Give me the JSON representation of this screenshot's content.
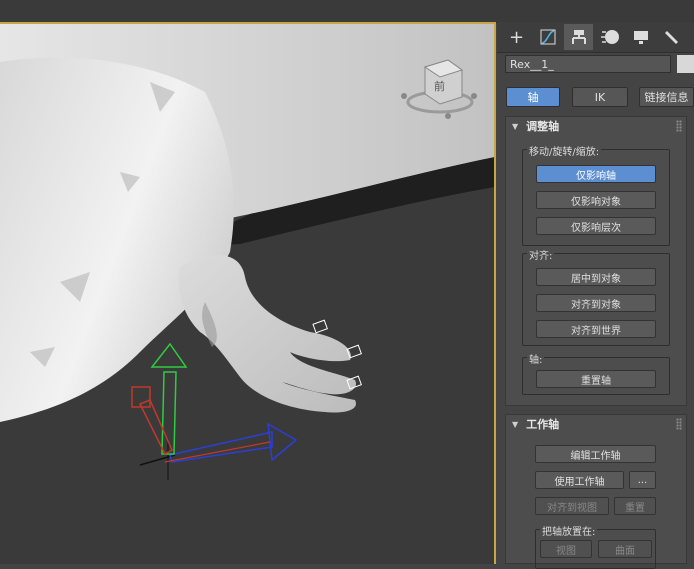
{
  "panel": {
    "tabs": [
      {
        "icon": "create-plus-icon"
      },
      {
        "icon": "modify-curve-icon"
      },
      {
        "icon": "hierarchy-icon",
        "active": true
      },
      {
        "icon": "motion-icon"
      },
      {
        "icon": "display-monitor-icon"
      },
      {
        "icon": "utilities-wrench-icon"
      }
    ],
    "object_name": "Rex__1_",
    "subtabs": {
      "pivot": "轴",
      "ik": "IK",
      "link_info": "链接信息"
    },
    "adjust_pivot": {
      "title": "调整轴",
      "move_rotate_scale": {
        "label": "移动/旋转/缩放:",
        "affect_pivot_only": "仅影响轴",
        "affect_object_only": "仅影响对象",
        "affect_hierarchy_only": "仅影响层次"
      },
      "alignment": {
        "label": "对齐:",
        "center_to_object": "居中到对象",
        "align_to_object": "对齐到对象",
        "align_to_world": "对齐到世界"
      },
      "pivot": {
        "label": "轴:",
        "reset_pivot": "重置轴"
      }
    },
    "working_pivot": {
      "title": "工作轴",
      "edit_working_pivot": "编辑工作轴",
      "use_working_pivot": "使用工作轴",
      "more": "...",
      "align_to_view": "对齐到视图",
      "reset": "重置",
      "place_pivot_to": {
        "label": "把轴放置在:",
        "view": "视图",
        "surface": "曲面"
      }
    }
  },
  "viewcube": {
    "face_label": "前"
  },
  "colors": {
    "accent": "#5b8fd2",
    "viewport_border": "#c9a545",
    "gizmo_x": "#c0392b",
    "gizmo_y": "#2ecc40",
    "gizmo_z": "#2a3fd6"
  }
}
